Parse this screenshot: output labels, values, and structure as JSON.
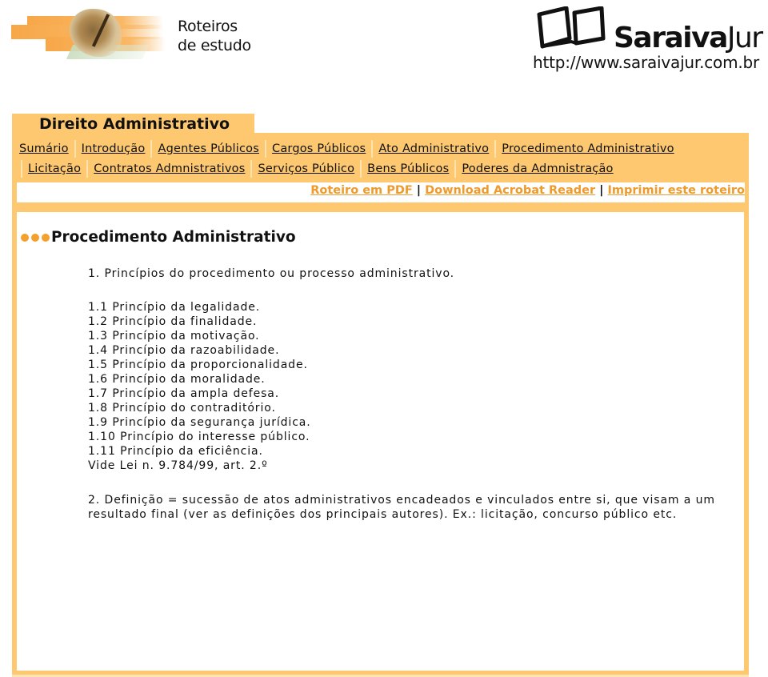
{
  "header": {
    "logo_left_line1": "Roteiros",
    "logo_left_line2": "de estudo",
    "brand_bold": "Saraiva",
    "brand_light": "Jur",
    "site_url": "http://www.saraivajur.com.br"
  },
  "section": {
    "title": "Direito Administrativo"
  },
  "nav": {
    "row1": [
      {
        "label": "Sumário"
      },
      {
        "label": "Introdução"
      },
      {
        "label": "Agentes Públicos"
      },
      {
        "label": "Cargos Públicos"
      },
      {
        "label": "Ato Administrativo"
      },
      {
        "label": "Procedimento Administrativo"
      }
    ],
    "row2": [
      {
        "label": "Licitação"
      },
      {
        "label": "Contratos Admnistrativos"
      },
      {
        "label": "Serviços Público"
      },
      {
        "label": "Bens Públicos"
      },
      {
        "label": "Poderes da Admnistração"
      }
    ]
  },
  "actions": {
    "pdf_label": "Roteiro em PDF",
    "acrobat_label": "Download Acrobat Reader",
    "print_label": "Imprimir este roteiro",
    "separator": "|",
    "accent_color": "#ee9a2c"
  },
  "content": {
    "heading": "Procedimento Administrativo",
    "intro": "1. Princípios do procedimento ou processo administrativo.",
    "principles": [
      "1.1 Princípio da legalidade.",
      "1.2 Princípio da finalidade.",
      "1.3 Princípio da motivação.",
      "1.4 Princípio da razoabilidade.",
      "1.5 Princípio da proporcionalidade.",
      "1.6 Princípio da moralidade.",
      "1.7 Princípio da ampla defesa.",
      "1.8 Princípio do contraditório.",
      "1.9 Princípio da segurança jurídica.",
      "1.10 Princípio do interesse público.",
      "1.11 Princípio da eficiência.",
      "Vide Lei n. 9.784/99, art. 2.º"
    ],
    "definition": "2. Definição = sucessão de atos administrativos encadeados e vinculados entre si, que visam a um resultado final (ver as definições dos principais autores). Ex.: licitação, concurso público etc."
  },
  "colors": {
    "frame": "#fdc86f",
    "bullet": "#f4a02c"
  }
}
